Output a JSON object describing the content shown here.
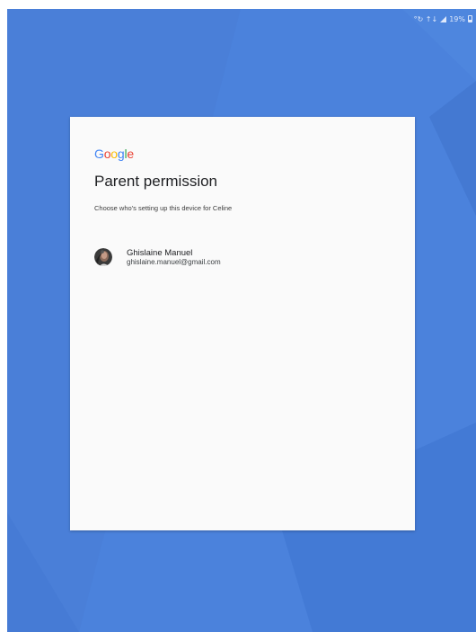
{
  "status_bar": {
    "left_icons": "°↻ ↑↓",
    "battery_text": "19%",
    "icons": [
      "wifi-icon",
      "signal-icon",
      "battery-icon"
    ]
  },
  "card": {
    "logo": {
      "letters": [
        "G",
        "o",
        "o",
        "g",
        "l",
        "e"
      ],
      "colors": [
        "#4285F4",
        "#EA4335",
        "#FBBC05",
        "#4285F4",
        "#34A853",
        "#EA4335"
      ]
    },
    "title": "Parent permission",
    "subtitle": "Choose who's setting up this device for Celine",
    "accounts": [
      {
        "name": "Ghislaine Manuel",
        "email": "ghislaine.manuel@gmail.com",
        "avatar": "avatar-photo"
      }
    ]
  },
  "colors": {
    "background": "#4a80d9",
    "card": "#fafafa",
    "title_text": "#202124"
  }
}
